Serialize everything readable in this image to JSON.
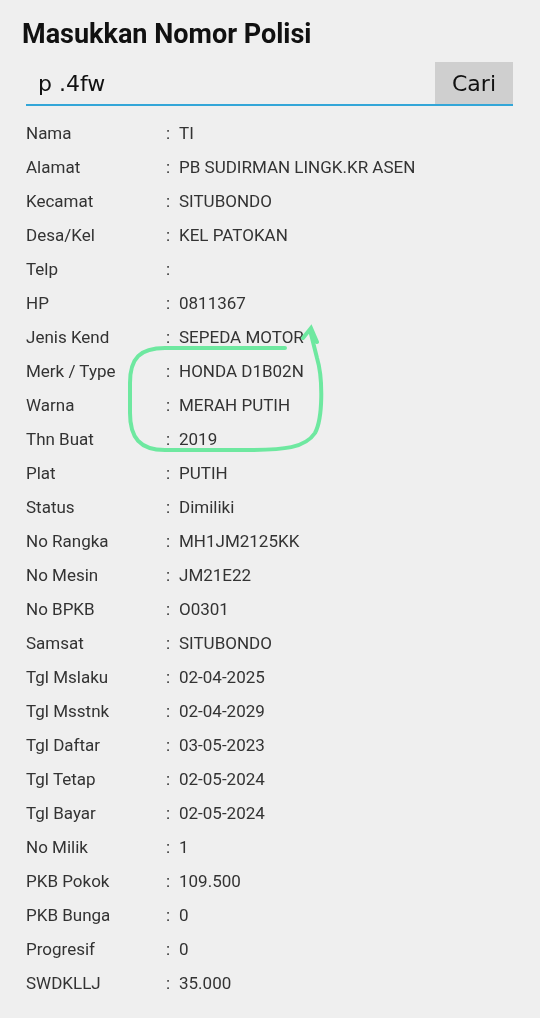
{
  "title": "Masukkan Nomor Polisi",
  "search": {
    "value": "p .4fw",
    "button": "Cari"
  },
  "rows": [
    {
      "label": "Nama",
      "value": "TI"
    },
    {
      "label": "Alamat",
      "value": "PB SUDIRMAN LINGK.KR ASEN"
    },
    {
      "label": "Kecamat",
      "value": "SITUBONDO"
    },
    {
      "label": "Desa/Kel",
      "value": "KEL PATOKAN"
    },
    {
      "label": "Telp",
      "value": ""
    },
    {
      "label": "HP",
      "value": "0811367"
    },
    {
      "label": "Jenis Kend",
      "value": "SEPEDA MOTOR"
    },
    {
      "label": "Merk / Type",
      "value": "HONDA D1B02N"
    },
    {
      "label": "Warna",
      "value": "MERAH PUTIH"
    },
    {
      "label": "Thn Buat",
      "value": "2019"
    },
    {
      "label": "Plat",
      "value": "PUTIH"
    },
    {
      "label": "Status",
      "value": "Dimiliki"
    },
    {
      "label": "No Rangka",
      "value": "MH1JM2125KK"
    },
    {
      "label": "No Mesin",
      "value": "JM21E22"
    },
    {
      "label": "No BPKB",
      "value": "O0301"
    },
    {
      "label": "Samsat",
      "value": "SITUBONDO"
    },
    {
      "label": "Tgl Mslaku",
      "value": "02-04-2025"
    },
    {
      "label": "Tgl Msstnk",
      "value": "02-04-2029"
    },
    {
      "label": "Tgl Daftar",
      "value": "03-05-2023"
    },
    {
      "label": "Tgl Tetap",
      "value": "02-05-2024"
    },
    {
      "label": "Tgl Bayar",
      "value": "02-05-2024"
    },
    {
      "label": "No Milik",
      "value": "1"
    },
    {
      "label": "PKB Pokok",
      "value": "109.500"
    },
    {
      "label": "PKB Bunga",
      "value": "0"
    },
    {
      "label": "Progresif",
      "value": "0"
    },
    {
      "label": "SWDKLLJ",
      "value": "35.000"
    }
  ],
  "colon": ":"
}
